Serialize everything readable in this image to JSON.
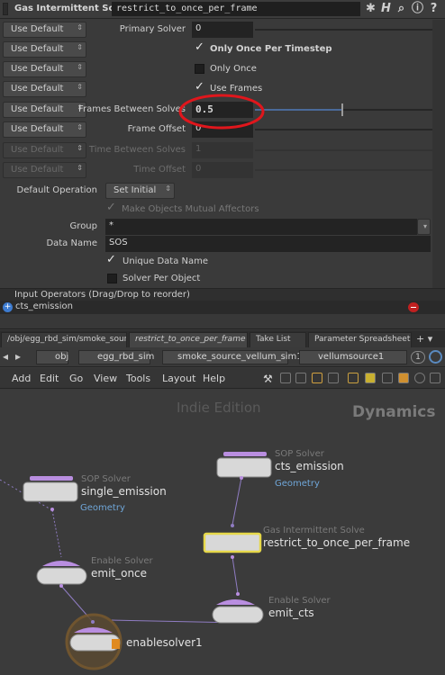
{
  "header": {
    "node_type": "Gas Intermittent Solve",
    "node_name": "restrict_to_once_per_frame",
    "icons": [
      "gear-icon",
      "help-icon",
      "search-icon",
      "info-icon",
      "question-icon"
    ]
  },
  "params": {
    "default_label": "Use Default",
    "primary_solver": {
      "label": "Primary Solver",
      "value": "0"
    },
    "only_once_per_timestep": {
      "label": "Only Once Per Timestep",
      "checked": true
    },
    "only_once": {
      "label": "Only Once",
      "checked": false
    },
    "use_frames": {
      "label": "Use Frames",
      "checked": true
    },
    "frames_between_solves": {
      "label": "Frames Between Solves",
      "value": "0.5"
    },
    "frame_offset": {
      "label": "Frame Offset",
      "value": "0"
    },
    "time_between_solves": {
      "label": "Time Between Solves",
      "value": "1"
    },
    "time_offset": {
      "label": "Time Offset",
      "value": "0"
    },
    "default_operation": {
      "label": "Default Operation",
      "value": "Set Initial"
    },
    "make_mutual": {
      "label": "Make Objects Mutual Affectors",
      "checked": true
    },
    "group": {
      "label": "Group",
      "value": "*"
    },
    "data_name": {
      "label": "Data Name",
      "value": "SOS"
    },
    "unique_data_name": {
      "label": "Unique Data Name",
      "checked": true
    },
    "solver_per_object": {
      "label": "Solver Per Object",
      "checked": false
    }
  },
  "inputs": {
    "header": "Input Operators (Drag/Drop to reorder)",
    "items": [
      "cts_emission"
    ]
  },
  "tabs": [
    {
      "label": "/obj/egg_rbd_sim/smoke_sour..."
    },
    {
      "label": "restrict_to_once_per_frame"
    },
    {
      "label": "Take List"
    },
    {
      "label": "Parameter Spreadsheet"
    }
  ],
  "path": {
    "crumbs": [
      "obj",
      "egg_rbd_sim",
      "smoke_source_vellum_sim1",
      "vellumsource1"
    ],
    "page_number": "1"
  },
  "menu": [
    "Add",
    "Edit",
    "Go",
    "View",
    "Tools",
    "Layout",
    "Help"
  ],
  "network": {
    "watermark_edition": "Indie Edition",
    "watermark_context": "Dynamics",
    "nodes": [
      {
        "type": "SOP Solver",
        "name": "single_emission",
        "comment": "Geometry"
      },
      {
        "type": "SOP Solver",
        "name": "cts_emission",
        "comment": "Geometry"
      },
      {
        "type": "Gas Intermittent Solve",
        "name": "restrict_to_once_per_frame"
      },
      {
        "type": "Enable Solver",
        "name": "emit_once"
      },
      {
        "type": "Enable Solver",
        "name": "emit_cts"
      },
      {
        "type": "",
        "name": "enablesolver1"
      }
    ]
  },
  "colors": {
    "node_flag": "#b98ee0",
    "selected_outline": "#e6d84a",
    "annotation_red": "#e0161c",
    "comment_blue": "#6fa6d8",
    "display_ring": "#7a5a2e"
  }
}
